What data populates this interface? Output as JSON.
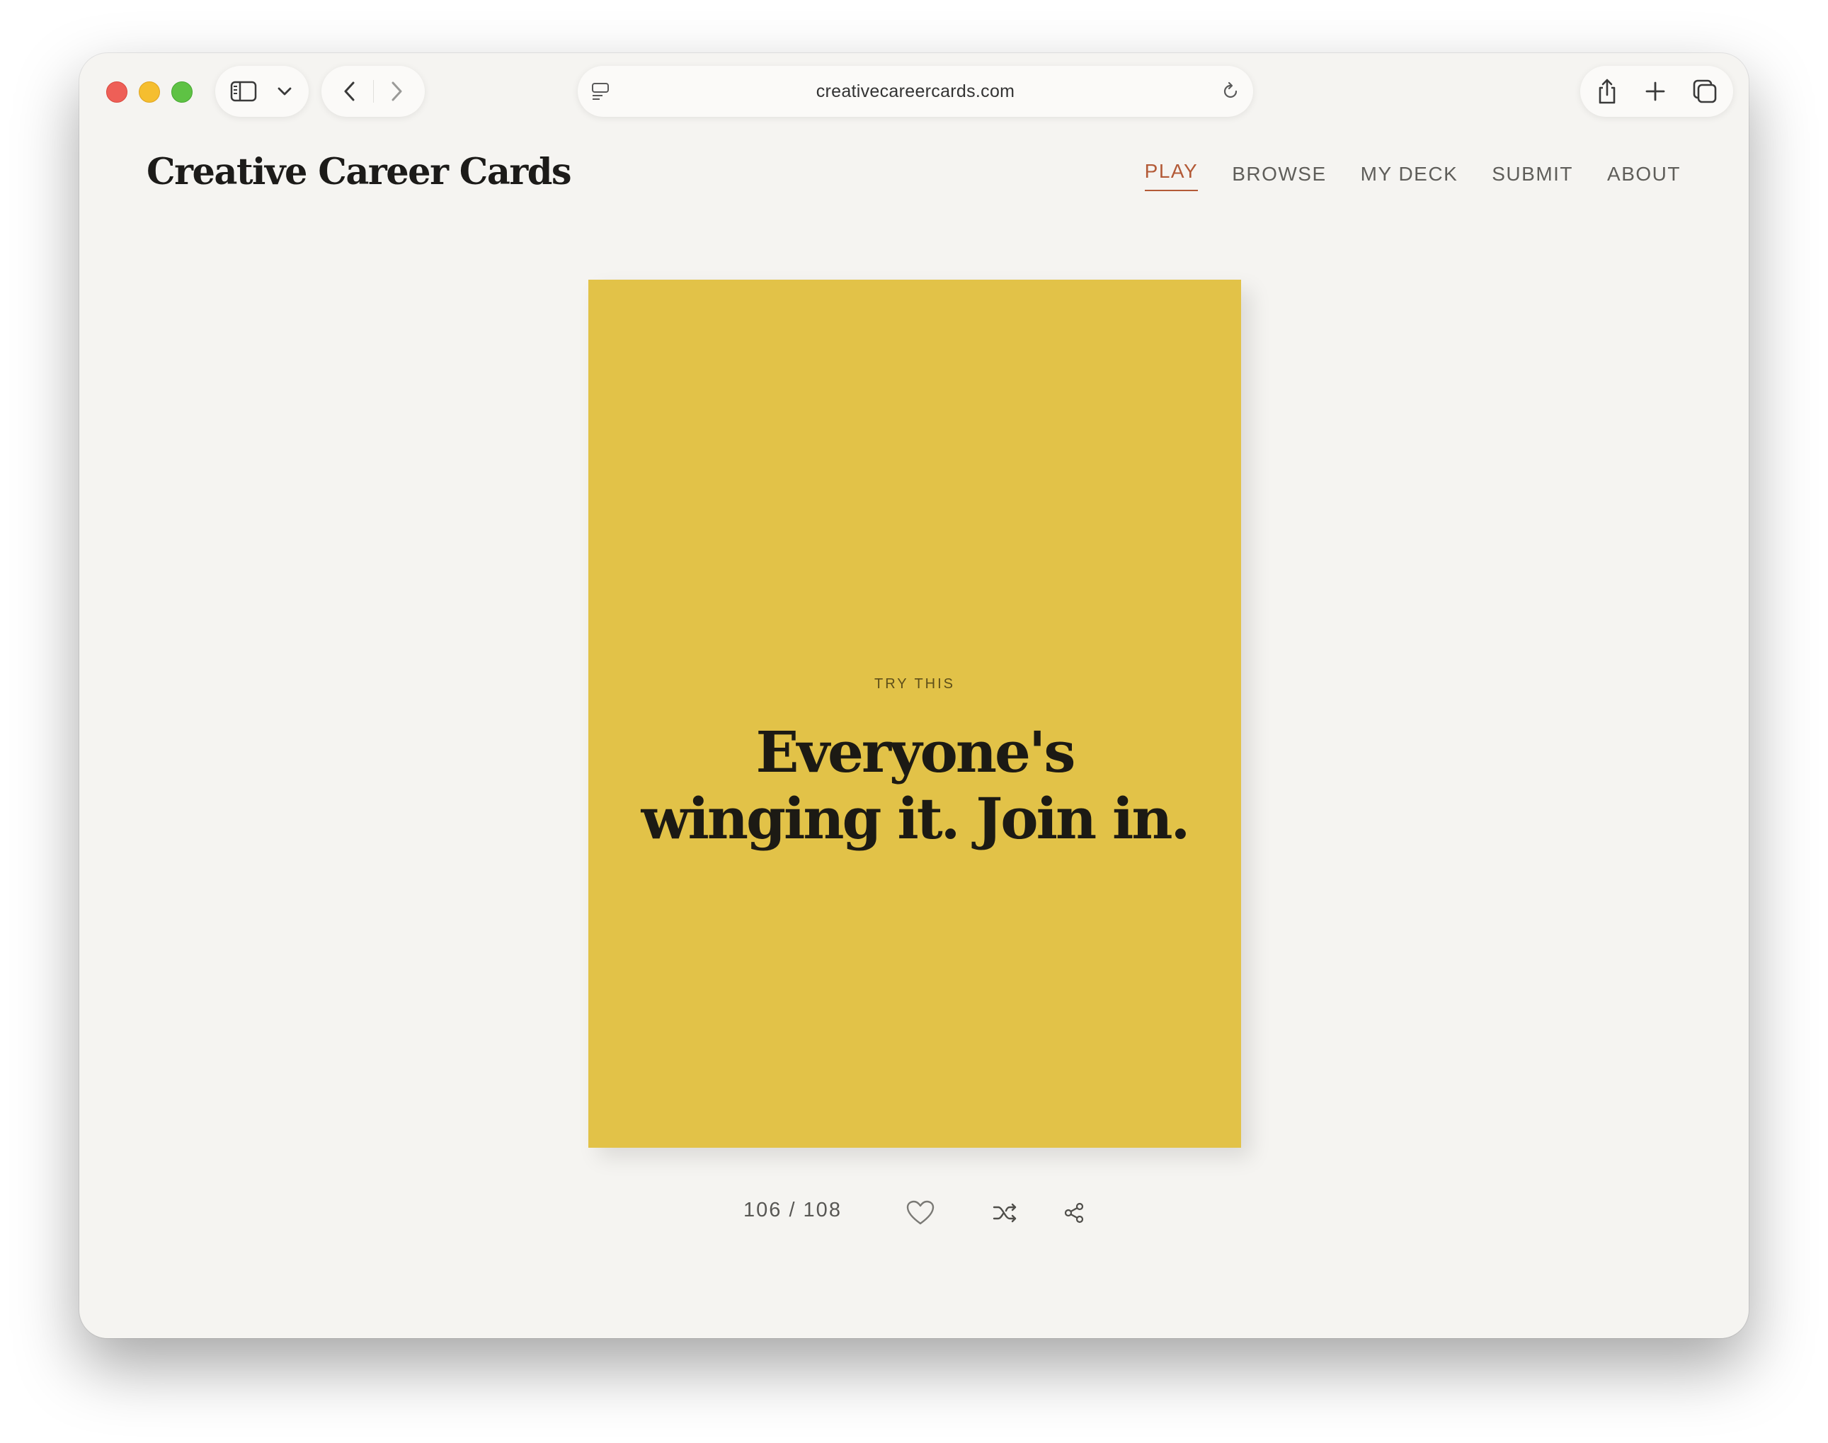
{
  "browser": {
    "url": "creativecareercards.com"
  },
  "site": {
    "logo": "Creative Career Cards",
    "nav": [
      {
        "label": "PLAY",
        "active": true
      },
      {
        "label": "BROWSE",
        "active": false
      },
      {
        "label": "MY DECK",
        "active": false
      },
      {
        "label": "SUBMIT",
        "active": false
      },
      {
        "label": "ABOUT",
        "active": false
      }
    ]
  },
  "card": {
    "eyebrow": "TRY THIS",
    "headline_line1": "Everyone's",
    "headline_line2": "winging it. Join in.",
    "color": "#e2c248"
  },
  "controls": {
    "counter": "106 / 108",
    "icons": [
      "heart-icon",
      "shuffle-icon",
      "share-icon"
    ]
  },
  "colors": {
    "accent": "#b35a37",
    "page_bg": "#f5f4f1",
    "text": "#1c1b19"
  }
}
